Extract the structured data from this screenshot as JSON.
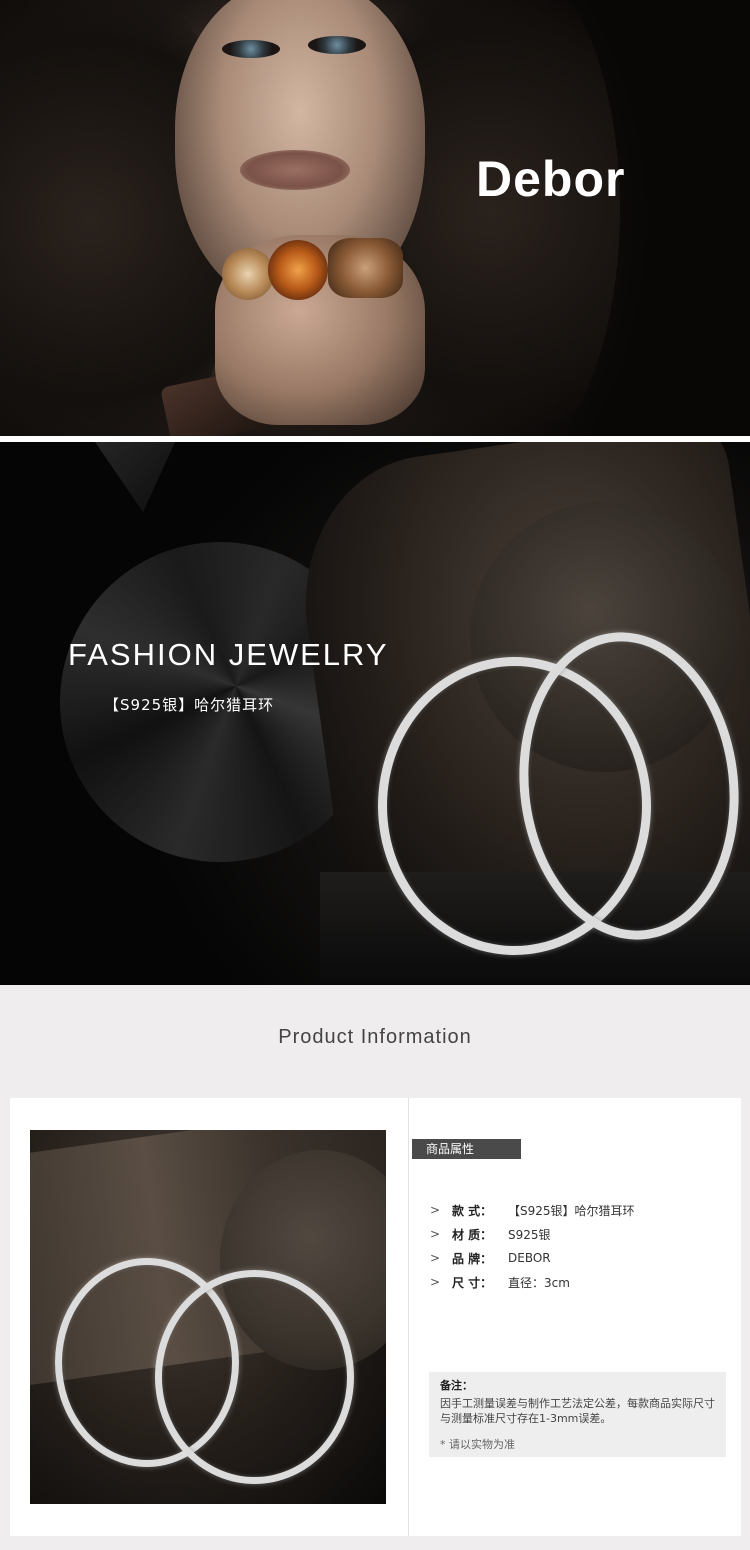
{
  "banner": {
    "brand": "Debor"
  },
  "hero": {
    "headline": "FASHION JEWELRY",
    "subheadline": "【S925银】哈尔猎耳环"
  },
  "product_info": {
    "section_title": "Product Information",
    "tag_label": "商品属性",
    "specs": [
      {
        "label": "款  式：",
        "value": "【S925银】哈尔猎耳环"
      },
      {
        "label": "材  质：",
        "value": "S925银"
      },
      {
        "label": "品  牌：",
        "value": "DEBOR"
      },
      {
        "label": "尺  寸：",
        "value": "直径：3cm"
      }
    ],
    "note": {
      "title": "备注：",
      "body": "因手工测量误差与制作工艺法定公差，每款商品实际尺寸与测量标准尺寸存在1-3mm误差。",
      "footer": "* 请以实物为准"
    }
  },
  "colors": {
    "page_bg": "#efeded",
    "tag_bg": "#4a4a4a",
    "note_bg": "#eeeeee"
  }
}
